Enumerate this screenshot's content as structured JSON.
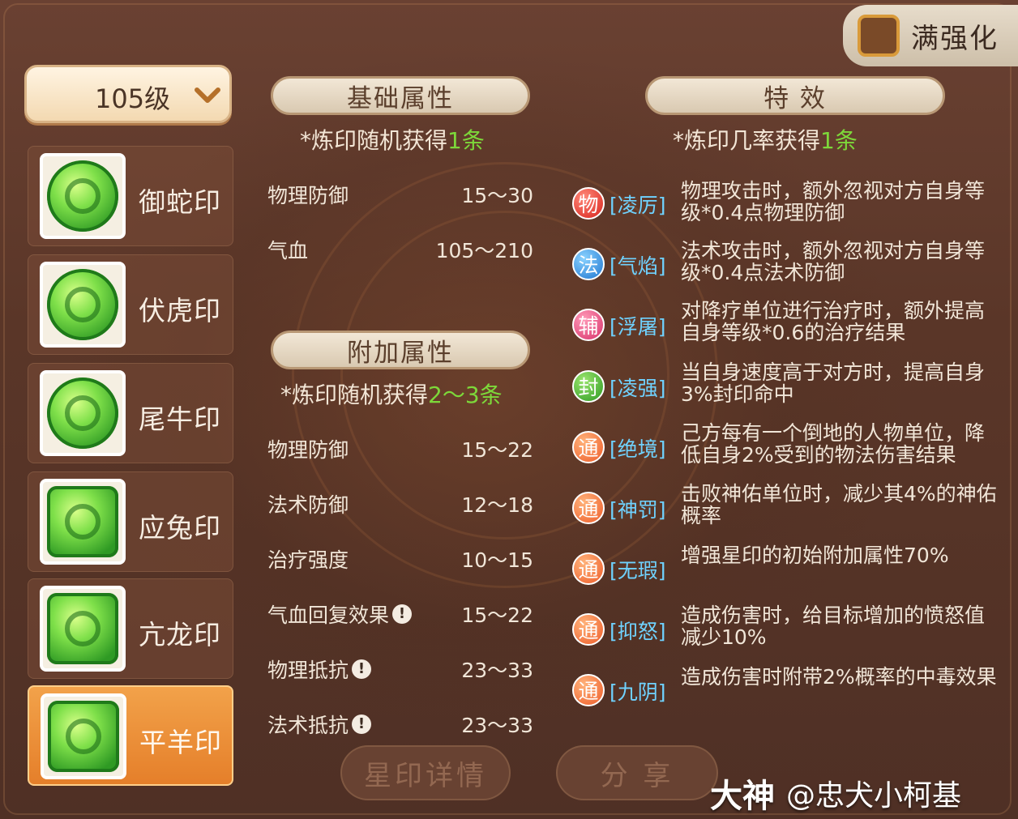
{
  "top_right": {
    "full_enhance_label": "满强化"
  },
  "level_select": {
    "value": "105级"
  },
  "seals": [
    {
      "name": "御蛇印",
      "icon": "snake-jade-icon",
      "selected": false
    },
    {
      "name": "伏虎印",
      "icon": "tiger-jade-icon",
      "selected": false
    },
    {
      "name": "尾牛印",
      "icon": "ox-jade-icon",
      "selected": false
    },
    {
      "name": "应兔印",
      "icon": "rabbit-jade-icon",
      "selected": false
    },
    {
      "name": "亢龙印",
      "icon": "dragon-jade-icon",
      "selected": false
    },
    {
      "name": "平羊印",
      "icon": "goat-jade-icon",
      "selected": true
    }
  ],
  "base_attrs": {
    "header": "基础属性",
    "note_prefix": "*炼印随机获得",
    "note_count": "1条",
    "rows": [
      {
        "name": "物理防御",
        "range": "15～30"
      },
      {
        "name": "气血",
        "range": "105～210"
      }
    ]
  },
  "extra_attrs": {
    "header": "附加属性",
    "note_prefix": "*炼印随机获得",
    "note_count": "2～3条",
    "rows": [
      {
        "name": "物理防御",
        "range": "15～22",
        "info": false
      },
      {
        "name": "法术防御",
        "range": "12～18",
        "info": false
      },
      {
        "name": "治疗强度",
        "range": "10～15",
        "info": false
      },
      {
        "name": "气血回复效果",
        "range": "15～22",
        "info": true
      },
      {
        "name": "物理抵抗",
        "range": "23～33",
        "info": true
      },
      {
        "name": "法术抵抗",
        "range": "23～33",
        "info": true
      }
    ]
  },
  "effects": {
    "header": "特 效",
    "note_prefix": "*炼印几率获得",
    "note_count": "1条",
    "items": [
      {
        "badge": "物",
        "tag": "[凌厉]",
        "desc": "物理攻击时，额外忽视对方自身等级*0.4点物理防御"
      },
      {
        "badge": "法",
        "tag": "[气焰]",
        "desc": "法术攻击时，额外忽视对方自身等级*0.4点法术防御"
      },
      {
        "badge": "辅",
        "tag": "[浮屠]",
        "desc": "对降疗单位进行治疗时，额外提高自身等级*0.6的治疗结果"
      },
      {
        "badge": "封",
        "tag": "[凌强]",
        "desc": "当自身速度高于对方时，提高自身3%封印命中"
      },
      {
        "badge": "通",
        "tag": "[绝境]",
        "desc": "己方每有一个倒地的人物单位，降低自身2%受到的物法伤害结果"
      },
      {
        "badge": "通",
        "tag": "[神罚]",
        "desc": "击败神佑单位时，减少其4%的神佑概率"
      },
      {
        "badge": "通",
        "tag": "[无瑕]",
        "desc": "增强星印的初始附加属性70%"
      },
      {
        "badge": "通",
        "tag": "[抑怒]",
        "desc": "造成伤害时，给目标增加的愤怒值减少10%"
      },
      {
        "badge": "通",
        "tag": "[九阴]",
        "desc": "造成伤害时附带2%概率的中毒效果"
      }
    ]
  },
  "bottom": {
    "detail_label": "星印详情",
    "share_label": "分 享"
  },
  "watermark": {
    "brand": "大神",
    "handle": "@忠犬小柯基"
  }
}
